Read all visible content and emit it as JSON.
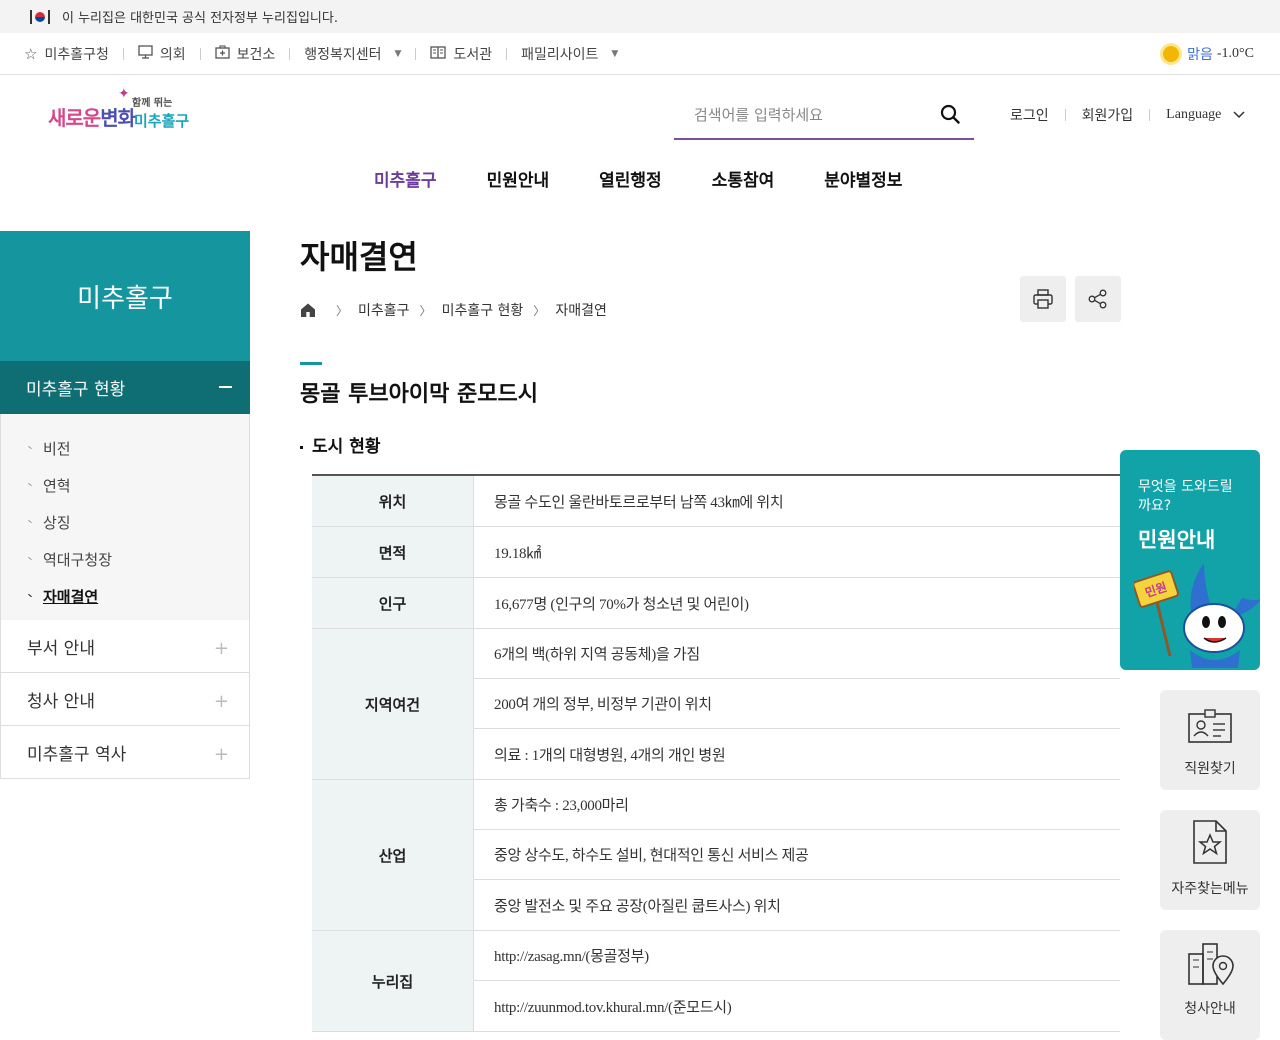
{
  "gov_banner": {
    "text": "이 누리집은 대한민국 공식 전자정부 누리집입니다."
  },
  "util_nav": {
    "items": [
      {
        "label": "미추홀구청",
        "icon": "star-icon"
      },
      {
        "label": "의회",
        "icon": "podium-icon"
      },
      {
        "label": "보건소",
        "icon": "medical-icon"
      },
      {
        "label": "행정복지센터",
        "icon": "",
        "dropdown": true
      },
      {
        "label": "도서관",
        "icon": "book-icon"
      },
      {
        "label": "패밀리사이트",
        "icon": "",
        "dropdown": true
      }
    ],
    "weather": {
      "state": "맑음",
      "temp": "-1.0°C",
      "icon": "sun-icon"
    }
  },
  "logo": {
    "line1": "새로운",
    "line1b": "변화",
    "line2": "함께 뛰는",
    "line3": "미추홀구"
  },
  "search": {
    "placeholder": "검색어를 입력하세요"
  },
  "auth": {
    "login": "로그인",
    "signup": "회원가입",
    "language": "Language"
  },
  "gnb": [
    "미추홀구",
    "민원안내",
    "열린행정",
    "소통참여",
    "분야별정보"
  ],
  "sidebar": {
    "title": "미추홀구",
    "current": "미추홀구 현황",
    "sub_items": [
      "비전",
      "연혁",
      "상징",
      "역대구청장",
      "자매결연"
    ],
    "menus": [
      "부서 안내",
      "청사 안내",
      "미추홀구 역사"
    ]
  },
  "page": {
    "title": "자매결연",
    "breadcrumb": [
      "미추홀구",
      "미추홀구 현황",
      "자매결연"
    ],
    "section_title": "몽골 투브아이막 준모드시",
    "sub_title": "도시 현황"
  },
  "table": [
    {
      "header": "위치",
      "values": [
        "몽골 수도인 울란바토르로부터 남쪽 43㎞에 위치"
      ]
    },
    {
      "header": "면적",
      "values": [
        "19.18㎢"
      ]
    },
    {
      "header": "인구",
      "values": [
        "16,677명 (인구의 70%가 청소년 및 어린이)"
      ]
    },
    {
      "header": "지역여건",
      "values": [
        "6개의 백(하위 지역 공동체)을 가짐",
        "200여 개의 정부, 비정부 기관이 위치",
        "의료 : 1개의 대형병원, 4개의 개인 병원"
      ]
    },
    {
      "header": "산업",
      "values": [
        "총 가축수 : 23,000마리",
        "중앙 상수도, 하수도 설비, 현대적인 통신 서비스 제공",
        "중앙 발전소 및 주요 공장(아질린 쿱트사스) 위치"
      ]
    },
    {
      "header": "누리집",
      "values": [
        "http://zasag.mn/(몽골정부)",
        "http://zuunmod.tov.khural.mn/(준모드시)"
      ]
    }
  ],
  "quick_menu": {
    "civil": {
      "question": "무엇을 도와드릴까요?",
      "title": "민원안내",
      "sign": "민원"
    },
    "items": [
      "직원찾기",
      "자주찾는메뉴",
      "청사안내"
    ]
  },
  "colors": {
    "teal": "#15959e",
    "teal_dark": "#0e6e73",
    "purple": "#6a3d9a",
    "quick_teal": "#12a3a8"
  }
}
